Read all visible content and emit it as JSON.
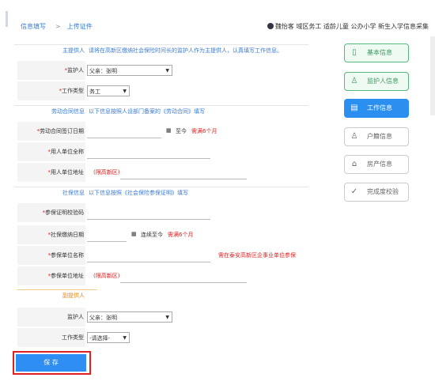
{
  "breadcrumb": {
    "item1": "信息填写",
    "sep": ">",
    "item2": "上传证件"
  },
  "user": {
    "text": "魏怡客 域区务工 适龄儿童 公办小学 新生入学信息采集"
  },
  "sections": {
    "main": {
      "title": "主提供人",
      "desc": "请将在高新区缴纳社会保险时间长的监护人作为主提供人，认真填写工作信息。"
    },
    "contract": {
      "title": "劳动合同信息",
      "desc": "以下信息按照人设部门备案的《劳动合同》填写"
    },
    "social": {
      "title": "社保信息",
      "desc": "以下信息按照《社会保险参保证明》填写"
    },
    "secondary": {
      "title": "副提供人"
    }
  },
  "fields": {
    "guardian": {
      "label": "监护人",
      "value": "父亲：张明"
    },
    "work_type": {
      "label": "工作类型",
      "value": "务工"
    },
    "contract_date": {
      "label": "劳动合同签订日期",
      "to": "至今",
      "note": "需满6个月"
    },
    "employer_name": {
      "label": "用人单位全称"
    },
    "employer_addr": {
      "label": "用人单位地址",
      "note": "(限高新区)"
    },
    "insurance_code": {
      "label": "参保证明校验码"
    },
    "insurance_date": {
      "label": "社保缴纳日期",
      "to": "连续至今",
      "note": "需满6个月"
    },
    "insured_unit": {
      "label": "参保单位名称",
      "note": "需在泰安高新区企事业单位参保"
    },
    "insured_addr": {
      "label": "参保单位地址",
      "note": "(限高新区)"
    },
    "guardian2": {
      "label": "监护人",
      "value": "父亲：张明"
    },
    "work_type2": {
      "label": "工作类型",
      "value": "-请选择-"
    }
  },
  "sidebar": {
    "items": [
      {
        "label": "基本信息",
        "state": "done"
      },
      {
        "label": "监护人信息",
        "state": "done"
      },
      {
        "label": "工作信息",
        "state": "active"
      },
      {
        "label": "户籍信息",
        "state": "todo"
      },
      {
        "label": "房产信息",
        "state": "todo"
      },
      {
        "label": "完成度校验",
        "state": "todo"
      }
    ]
  },
  "save_label": "保 存",
  "colors": {
    "accent": "#2f8ef4",
    "required": "#e02020",
    "done": "#3a9a5c"
  }
}
